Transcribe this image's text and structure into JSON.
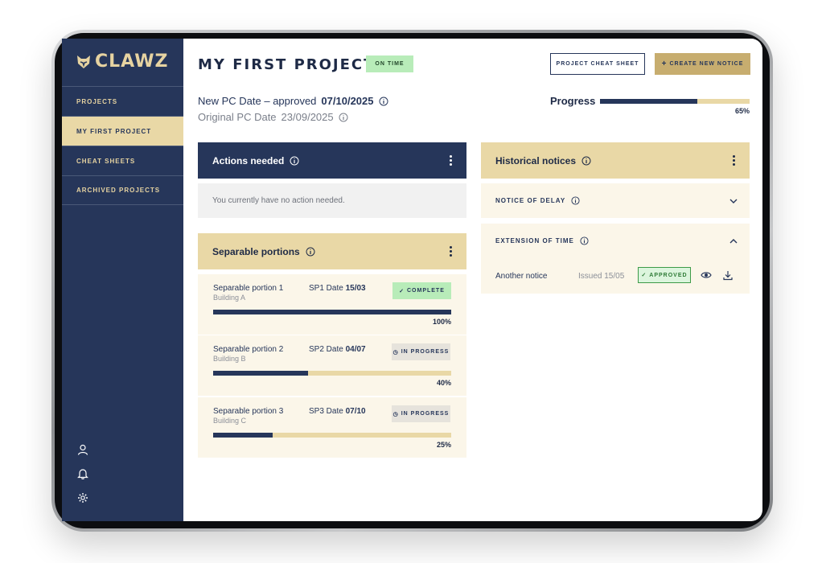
{
  "app": {
    "logo_text": "CLAWZ"
  },
  "sidebar": {
    "items": [
      {
        "label": "PROJECTS",
        "active": false
      },
      {
        "label": "MY FIRST PROJECT",
        "active": true
      },
      {
        "label": "CHEAT SHEETS",
        "active": false
      },
      {
        "label": "ARCHIVED PROJECTS",
        "active": false
      }
    ],
    "bottom_icons": [
      "user-icon",
      "bell-icon",
      "gear-icon"
    ]
  },
  "header": {
    "title": "MY FIRST PROJECT",
    "status_badge": "ON TIME",
    "cheat_sheet_button": "PROJECT CHEAT SHEET",
    "create_notice_button": "CREATE NEW NOTICE"
  },
  "dates": {
    "new_pc_label": "New PC Date – approved",
    "new_pc_value": "07/10/2025",
    "original_pc_label": "Original PC Date",
    "original_pc_value": "23/09/2025"
  },
  "progress": {
    "label": "Progress",
    "value": 0.65,
    "percent_text": "65%"
  },
  "actions_panel": {
    "title": "Actions needed",
    "empty_text": "You currently have no action needed."
  },
  "separable_portions": {
    "title": "Separable portions",
    "rows": [
      {
        "name": "Separable portion 1",
        "building": "Building A",
        "date_label": "SP1 Date",
        "date_value": "15/03",
        "status": "COMPLETE",
        "status_type": "complete",
        "progress": 1.0,
        "percent_text": "100%"
      },
      {
        "name": "Separable portion 2",
        "building": "Building B",
        "date_label": "SP2 Date",
        "date_value": "04/07",
        "status": "IN PROGRESS",
        "status_type": "progress",
        "progress": 0.4,
        "percent_text": "40%"
      },
      {
        "name": "Separable portion 3",
        "building": "Building C",
        "date_label": "SP3 Date",
        "date_value": "07/10",
        "status": "IN PROGRESS",
        "status_type": "progress",
        "progress": 0.25,
        "percent_text": "25%"
      }
    ]
  },
  "historical_notices": {
    "title": "Historical notices",
    "sections": [
      {
        "label": "NOTICE OF DELAY",
        "expanded": false
      },
      {
        "label": "EXTENSION OF TIME",
        "expanded": true
      }
    ],
    "notice": {
      "name": "Another notice",
      "issued": "Issued 15/05",
      "status": "APPROVED"
    }
  },
  "colors": {
    "navy": "#26365a",
    "gold": "#e9d8a6",
    "gold_dark": "#c7ad6f",
    "green_badge": "#b8ecb9"
  }
}
